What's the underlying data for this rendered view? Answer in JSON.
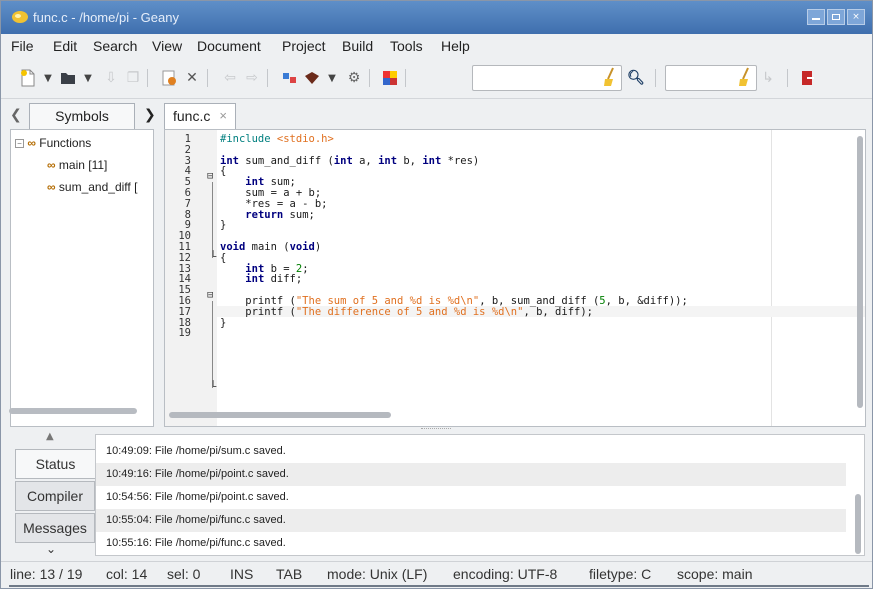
{
  "window": {
    "title": "func.c - /home/pi - Geany",
    "controls": {
      "minimize": "minimize",
      "maximize": "maximize",
      "close": "×"
    }
  },
  "menubar": {
    "items": [
      "File",
      "Edit",
      "Search",
      "View",
      "Document",
      "Project",
      "Build",
      "Tools",
      "Help"
    ]
  },
  "toolbar": {
    "icons": [
      "new-file-icon",
      "dropdown-arrow-icon",
      "open-folder-icon",
      "dropdown-arrow-icon",
      "save-icon",
      "save-all-icon",
      "revert-icon",
      "close-file-icon",
      "back-icon",
      "forward-icon",
      "compile-icon",
      "build-icon",
      "dropdown-arrow-icon",
      "run-icon",
      "color-chooser-icon",
      "clear-search-icon",
      "find-icon",
      "clear-goto-icon",
      "goto-line-icon",
      "quit-icon"
    ],
    "search_value": "",
    "goto_value": ""
  },
  "sidebar": {
    "tab_label": "Symbols",
    "tree": [
      {
        "label": "Functions",
        "level": 0
      },
      {
        "label": "main [11]",
        "level": 1
      },
      {
        "label": "sum_and_diff [",
        "level": 1
      }
    ]
  },
  "editor": {
    "tab_label": "func.c",
    "tab_close": "×",
    "lines": [
      "#include <stdio.h>",
      "",
      "int sum_and_diff (int a, int b, int *res)",
      "{",
      "    int sum;",
      "    sum = a + b;",
      "    *res = a - b;",
      "    return sum;",
      "}",
      "",
      "void main (void)",
      "{",
      "    int b = 2;",
      "    int diff;",
      "",
      "    printf (\"The sum of 5 and %d is %d\\n\", b, sum_and_diff (5, b, &diff));",
      "    printf (\"The difference of 5 and %d is %d\\n\", b, diff);",
      "}",
      ""
    ],
    "line_numbers": [
      "1",
      "2",
      "3",
      "4",
      "5",
      "6",
      "7",
      "8",
      "9",
      "10",
      "11",
      "12",
      "13",
      "14",
      "15",
      "16",
      "17",
      "18",
      "19"
    ]
  },
  "bottom_panel": {
    "tabs": [
      "Status",
      "Compiler",
      "Messages"
    ],
    "active_tab": "Status",
    "messages": [
      "10:49:09: File /home/pi/sum.c saved.",
      "10:49:16: File /home/pi/point.c saved.",
      "10:54:56: File /home/pi/point.c saved.",
      "10:55:04: File /home/pi/func.c saved.",
      "10:55:16: File /home/pi/func.c saved."
    ]
  },
  "statusbar": {
    "line": "line: 13 / 19",
    "col": "col: 14",
    "sel": "sel: 0",
    "ins": "INS",
    "tab": "TAB",
    "mode": "mode: Unix (LF)",
    "encoding": "encoding: UTF-8",
    "filetype": "filetype: C",
    "scope": "scope: main"
  },
  "colors": {
    "titlebar": "#4a7cbc",
    "keyword": "#00007f",
    "string": "#e07020",
    "number": "#007f00",
    "preprocessor": "#007f7f"
  }
}
